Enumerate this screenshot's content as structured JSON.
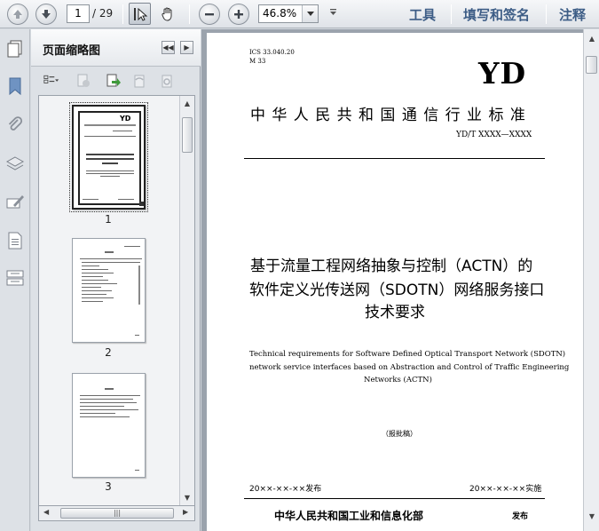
{
  "toolbar": {
    "current_page": "1",
    "page_total": "/ 29",
    "zoom": "46.8%",
    "tools_label": "工具",
    "sign_label": "填写和签名",
    "comment_label": "注释"
  },
  "panel": {
    "title": "页面缩略图",
    "thumbnails": [
      {
        "number": "1"
      },
      {
        "number": "2"
      },
      {
        "number": "3"
      }
    ]
  },
  "document": {
    "ics": "ICS 33.040.20",
    "classification": "M 33",
    "logo": "YD",
    "standard_title": "中 华 人 民 共 和 国 通 信 行 业 标 准",
    "standard_number": "YD/T XXXX—XXXX",
    "title_cn_line1": "基于流量工程网络抽象与控制（ACTN）的",
    "title_cn_line2": "软件定义光传送网（SDOTN）网络服务接口",
    "title_cn_line3": "技术要求",
    "title_en_line1": "Technical requirements for Software Defined Optical Transport Network (SDOTN)",
    "title_en_line2": "network service interfaces based on Abstraction and Control of Traffic Engineering",
    "title_en_line3": "Networks (ACTN)",
    "draft_status": "（报批稿）",
    "issue_date": "20××-××-××发布",
    "implement_date": "20××-××-××实施",
    "publisher": "中华人民共和国工业和信息化部",
    "publisher_suffix": "发布"
  }
}
